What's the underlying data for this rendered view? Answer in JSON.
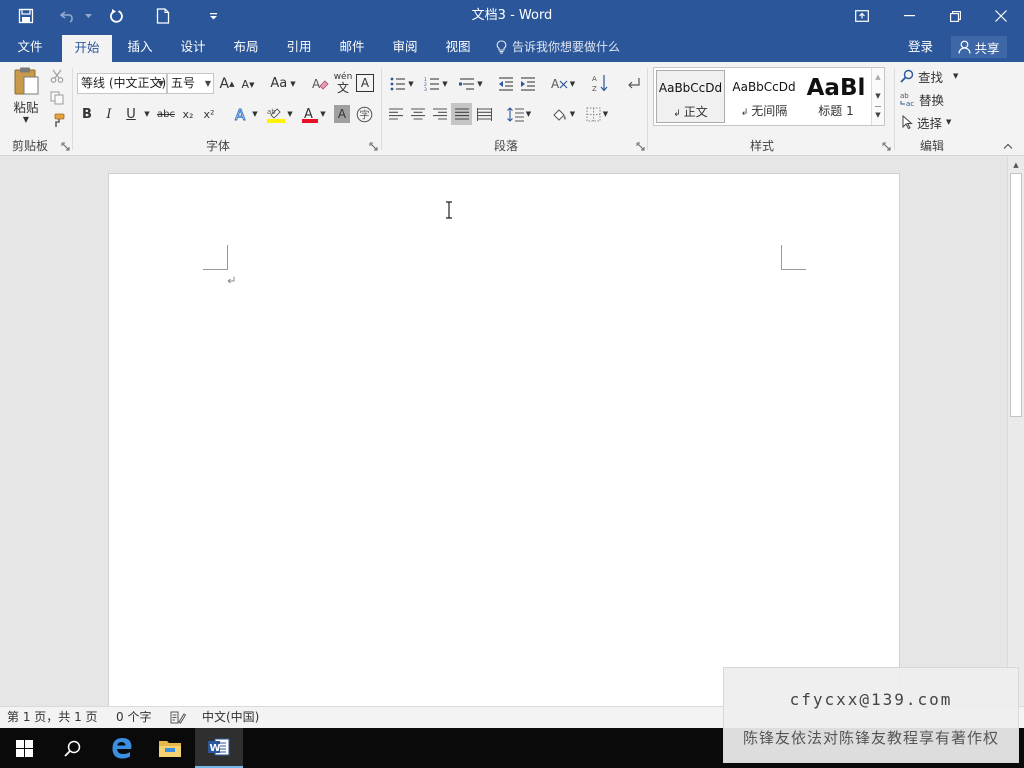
{
  "window": {
    "title": "文档3 - Word"
  },
  "tabs": [
    {
      "label": "文件"
    },
    {
      "label": "开始"
    },
    {
      "label": "插入"
    },
    {
      "label": "设计"
    },
    {
      "label": "布局"
    },
    {
      "label": "引用"
    },
    {
      "label": "邮件"
    },
    {
      "label": "审阅"
    },
    {
      "label": "视图"
    }
  ],
  "active_tab": "开始",
  "tell_me": {
    "placeholder": "告诉我你想要做什么"
  },
  "account": {
    "login_label": "登录",
    "share_label": "共享"
  },
  "ribbon": {
    "clipboard": {
      "group_label": "剪贴板",
      "paste_label": "粘贴"
    },
    "font": {
      "group_label": "字体",
      "font_name": "等线 (中文正文)",
      "font_size": "五号",
      "change_case_label": "Aa",
      "bold": "B",
      "italic": "I",
      "underline": "U",
      "strike": "abc",
      "subscript": "x₂",
      "superscript": "x²",
      "phonetic_top": "wén",
      "phonetic_bottom": "文",
      "border_char": "A",
      "font_color": "#e81123",
      "highlight_color": "#fff200"
    },
    "paragraph": {
      "group_label": "段落"
    },
    "styles": {
      "group_label": "样式",
      "items": [
        {
          "sample": "AaBbCcDd",
          "name": "正文"
        },
        {
          "sample": "AaBbCcDd",
          "name": "无间隔"
        },
        {
          "sample": "AaBl",
          "name": "标题 1"
        }
      ]
    },
    "editing": {
      "group_label": "编辑",
      "find_label": "查找",
      "replace_label": "替换",
      "select_label": "选择"
    }
  },
  "status": {
    "page": "第 1 页，共 1 页",
    "words": "0 个字",
    "language": "中文(中国)"
  },
  "watermark": {
    "email": "cfycxx@139.com",
    "notice": "陈锋友依法对陈锋友教程享有著作权"
  },
  "colors": {
    "brand": "#2b579a",
    "ribbon_bg": "#f3f3f3",
    "taskbar": "#0a0a0a"
  }
}
